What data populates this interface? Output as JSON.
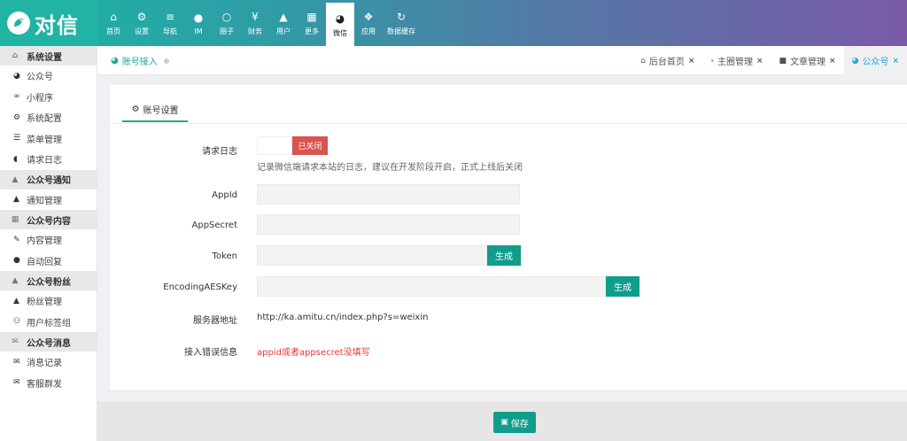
{
  "app": {
    "logo_text": "对信"
  },
  "topnav": [
    {
      "label": "首页",
      "icon": "home-icon",
      "glyph": "⌂"
    },
    {
      "label": "设置",
      "icon": "cogs-icon",
      "glyph": "⚙"
    },
    {
      "label": "导航",
      "icon": "bars-icon",
      "glyph": "≡"
    },
    {
      "label": "IM",
      "icon": "chat-bubble-icon",
      "glyph": "●"
    },
    {
      "label": "圈子",
      "icon": "comments-icon",
      "glyph": "○"
    },
    {
      "label": "财务",
      "icon": "yen-icon",
      "glyph": "¥"
    },
    {
      "label": "用户",
      "icon": "user-icon",
      "glyph": "▲"
    },
    {
      "label": "更多",
      "icon": "grid-icon",
      "glyph": "▦"
    },
    {
      "label": "微信",
      "icon": "wechat-icon",
      "glyph": "◕"
    },
    {
      "label": "应用",
      "icon": "puzzle-icon",
      "glyph": "❖"
    },
    {
      "label": "数据缓存",
      "icon": "refresh-icon",
      "glyph": "↻"
    }
  ],
  "sidebar": {
    "groups": [
      {
        "title": "系统设置",
        "icon": "home-icon",
        "glyph": "⌂",
        "items": [
          {
            "label": "公众号",
            "icon": "wechat-icon",
            "glyph": "◕"
          },
          {
            "label": "小程序",
            "icon": "link-icon",
            "glyph": "∞"
          },
          {
            "label": "系统配置",
            "icon": "cog-icon",
            "glyph": "⚙"
          },
          {
            "label": "菜单管理",
            "icon": "list-icon",
            "glyph": "☰"
          },
          {
            "label": "请求日志",
            "icon": "shield-icon",
            "glyph": "◖"
          }
        ]
      },
      {
        "title": "公众号通知",
        "icon": "user-icon",
        "glyph": "▲",
        "items": [
          {
            "label": "通知管理",
            "icon": "user-icon",
            "glyph": "▲"
          }
        ]
      },
      {
        "title": "公众号内容",
        "icon": "grid-icon",
        "glyph": "▦",
        "items": [
          {
            "label": "内容管理",
            "icon": "edit-icon",
            "glyph": "✎"
          },
          {
            "label": "自动回复",
            "icon": "comments-icon",
            "glyph": "●"
          }
        ]
      },
      {
        "title": "公众号粉丝",
        "icon": "user-icon",
        "glyph": "▲",
        "items": [
          {
            "label": "粉丝管理",
            "icon": "user-icon",
            "glyph": "▲"
          },
          {
            "label": "用户标签组",
            "icon": "users-icon",
            "glyph": "⚇"
          }
        ]
      },
      {
        "title": "公众号消息",
        "icon": "envelope-icon",
        "glyph": "✉",
        "items": [
          {
            "label": "消息记录",
            "icon": "envelope-icon",
            "glyph": "✉"
          },
          {
            "label": "客服群发",
            "icon": "envelope-open-icon",
            "glyph": "✉"
          }
        ]
      }
    ]
  },
  "breadcrumb": {
    "label": "账号接入"
  },
  "tabs": [
    {
      "label": "后台首页",
      "glyph": "⌂",
      "icon": "home-icon",
      "close": "×"
    },
    {
      "label": "主圈管理",
      "glyph": "›",
      "icon": "chevron-right-icon",
      "close": "×"
    },
    {
      "label": "文章管理",
      "glyph": "■",
      "icon": "file-icon",
      "close": "×"
    },
    {
      "label": "公众号",
      "glyph": "◕",
      "icon": "wechat-icon",
      "close": "×",
      "active": true
    }
  ],
  "card": {
    "tab_label": "账号设置",
    "tab_glyph": "⚙"
  },
  "form": {
    "log_label": "请求日志",
    "log_switch_state": "已关闭",
    "log_help": "记录微信端请求本站的日志，建议在开发阶段开启，正式上线后关闭",
    "appid_label": "AppId",
    "appid_value": "",
    "appsecret_label": "AppSecret",
    "appsecret_value": "",
    "token_label": "Token",
    "token_value": "",
    "aes_label": "EncodingAESKey",
    "aes_value": "",
    "generate_label": "生成",
    "server_label": "服务器地址",
    "server_value": "http://ka.amitu.cn/index.php?s=weixin",
    "error_label": "接入错误信息",
    "error_value": "appid或者appsecret没填写"
  },
  "footer": {
    "save_label": "保存",
    "save_glyph": "▣"
  },
  "colors": {
    "accent": "#109d8c",
    "danger": "#d9534f",
    "error_text": "#e53935"
  }
}
